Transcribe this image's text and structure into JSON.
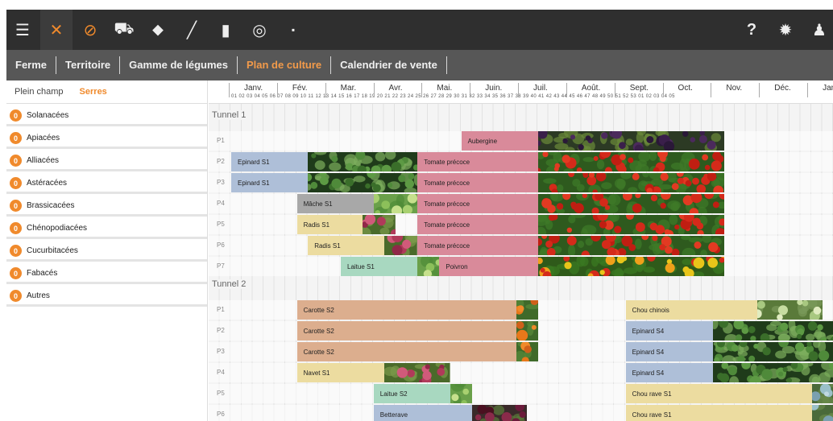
{
  "toolbar": {
    "items": [
      {
        "name": "menu-icon",
        "glyph": "☰"
      },
      {
        "name": "tools-icon",
        "glyph": "✕"
      },
      {
        "name": "compass-icon",
        "glyph": "⊘"
      },
      {
        "name": "tractor-icon",
        "glyph": "⛟"
      },
      {
        "name": "tag-icon",
        "glyph": "⬥"
      },
      {
        "name": "pen-icon",
        "glyph": "╱"
      },
      {
        "name": "bar-chart-icon",
        "glyph": "▮"
      },
      {
        "name": "gauge-icon",
        "glyph": "◎"
      },
      {
        "name": "flag-icon",
        "glyph": "▪"
      }
    ],
    "right": [
      {
        "name": "help-icon",
        "glyph": "?"
      },
      {
        "name": "settings-icon",
        "glyph": "✹"
      },
      {
        "name": "user-icon",
        "glyph": "♟"
      }
    ],
    "accent": "#f08a2c"
  },
  "subnav": {
    "tabs": [
      "Ferme",
      "Territoire",
      "Gamme de légumes",
      "Plan de culture",
      "Calendrier de vente"
    ],
    "active": "Plan de culture"
  },
  "sidebar": {
    "mode_open": "Plein champ",
    "mode_greenhouse": "Serres",
    "families": [
      {
        "count": "0",
        "name": "Solanacées"
      },
      {
        "count": "0",
        "name": "Apiacées"
      },
      {
        "count": "0",
        "name": "Alliacées"
      },
      {
        "count": "0",
        "name": "Astéracées"
      },
      {
        "count": "0",
        "name": "Brassicacées"
      },
      {
        "count": "0",
        "name": "Chénopodiacées"
      },
      {
        "count": "0",
        "name": "Cucurbitacées"
      },
      {
        "count": "0",
        "name": "Fabacés"
      },
      {
        "count": "0",
        "name": "Autres"
      }
    ]
  },
  "timeline": {
    "months": [
      "Janv.",
      "Fév.",
      "Mar.",
      "Avr.",
      "Mai.",
      "Juin.",
      "Juil.",
      "Août.",
      "Sept.",
      "Oct.",
      "Nov.",
      "Déc.",
      "Janv."
    ],
    "weeks": "01 02 03 04 05 06 07 08 09 10 11 12 13 14 15 16 17 18 19 20 21 22 23 24 25 26 27 28 29 30 31 32 33 34 35 36 37 38 39 40 41 42 43 44 45 46 47 48 49 50 51 52 53 01 02 03 04 05"
  },
  "tunnels": [
    {
      "name": "Tunnel 1",
      "rows": [
        {
          "label": "P1",
          "crops": [
            {
              "name": "Aubergine",
              "start": 22,
              "end": 29,
              "color": "#d98a9a",
              "photo": "aubergine",
              "pstart": 29,
              "pend": 46
            }
          ]
        },
        {
          "label": "P2",
          "crops": [
            {
              "name": "Epinard S1",
              "start": 1,
              "end": 8,
              "color": "#aebfd8",
              "photo": "spinach",
              "pstart": 8,
              "pend": 18
            },
            {
              "name": "Tomate précoce",
              "start": 18,
              "end": 29,
              "color": "#d98a9a",
              "photo": "tomato",
              "pstart": 29,
              "pend": 46
            }
          ]
        },
        {
          "label": "P3",
          "crops": [
            {
              "name": "Epinard S1",
              "start": 1,
              "end": 8,
              "color": "#aebfd8",
              "photo": "spinach",
              "pstart": 8,
              "pend": 18
            },
            {
              "name": "Tomate précoce",
              "start": 18,
              "end": 29,
              "color": "#d98a9a",
              "photo": "tomato",
              "pstart": 29,
              "pend": 46
            }
          ]
        },
        {
          "label": "P4",
          "crops": [
            {
              "name": "Mâche S1",
              "start": 7,
              "end": 14,
              "color": "#a8a8a8",
              "photo": "lettuce",
              "pstart": 14,
              "pend": 18
            },
            {
              "name": "Tomate précoce",
              "start": 18,
              "end": 29,
              "color": "#d98a9a",
              "photo": "tomato",
              "pstart": 29,
              "pend": 46
            }
          ]
        },
        {
          "label": "P5",
          "crops": [
            {
              "name": "Radis S1",
              "start": 7,
              "end": 13,
              "color": "#ecdca0",
              "photo": "radish",
              "pstart": 13,
              "pend": 16
            },
            {
              "name": "Tomate précoce",
              "start": 18,
              "end": 29,
              "color": "#d98a9a",
              "photo": "tomato",
              "pstart": 29,
              "pend": 46
            }
          ]
        },
        {
          "label": "P6",
          "crops": [
            {
              "name": "Radis S1",
              "start": 8,
              "end": 15,
              "color": "#ecdca0",
              "photo": "radish",
              "pstart": 15,
              "pend": 18
            },
            {
              "name": "Tomate précoce",
              "start": 18,
              "end": 29,
              "color": "#d98a9a",
              "photo": "tomato",
              "pstart": 29,
              "pend": 46
            }
          ]
        },
        {
          "label": "P7",
          "crops": [
            {
              "name": "Laitue S1",
              "start": 11,
              "end": 18,
              "color": "#a8d8c0",
              "photo": "lettuce",
              "pstart": 18,
              "pend": 20
            },
            {
              "name": "Poivron",
              "start": 20,
              "end": 29,
              "color": "#d98a9a",
              "photo": "pepper",
              "pstart": 29,
              "pend": 46
            }
          ]
        }
      ]
    },
    {
      "name": "Tunnel 2",
      "rows": [
        {
          "label": "P1",
          "crops": [
            {
              "name": "Carotte S2",
              "start": 7,
              "end": 27,
              "color": "#dcae8e",
              "photo": "carrot",
              "pstart": 27,
              "pend": 29
            },
            {
              "name": "Chou chinois",
              "start": 37,
              "end": 49,
              "color": "#ecdca0",
              "photo": "cabbage",
              "pstart": 49,
              "pend": 55
            }
          ]
        },
        {
          "label": "P2",
          "crops": [
            {
              "name": "Carotte S2",
              "start": 7,
              "end": 27,
              "color": "#dcae8e",
              "photo": "carrot",
              "pstart": 27,
              "pend": 29
            },
            {
              "name": "Epinard S4",
              "start": 37,
              "end": 45,
              "color": "#aebfd8",
              "photo": "spinach",
              "pstart": 45,
              "pend": 58
            }
          ]
        },
        {
          "label": "P3",
          "crops": [
            {
              "name": "Carotte S2",
              "start": 7,
              "end": 27,
              "color": "#dcae8e",
              "photo": "carrot",
              "pstart": 27,
              "pend": 29
            },
            {
              "name": "Epinard S4",
              "start": 37,
              "end": 45,
              "color": "#aebfd8",
              "photo": "spinach",
              "pstart": 45,
              "pend": 58
            }
          ]
        },
        {
          "label": "P4",
          "crops": [
            {
              "name": "Navet S1",
              "start": 7,
              "end": 15,
              "color": "#ecdca0",
              "photo": "radish",
              "pstart": 15,
              "pend": 21
            },
            {
              "name": "Epinard S4",
              "start": 37,
              "end": 45,
              "color": "#aebfd8",
              "photo": "spinach",
              "pstart": 45,
              "pend": 58
            }
          ]
        },
        {
          "label": "P5",
          "crops": [
            {
              "name": "Laitue S2",
              "start": 14,
              "end": 21,
              "color": "#a8d8c0",
              "photo": "lettuce",
              "pstart": 21,
              "pend": 23
            },
            {
              "name": "Chou rave S1",
              "start": 37,
              "end": 54,
              "color": "#ecdca0",
              "photo": "kohlrabi",
              "pstart": 54,
              "pend": 58
            }
          ]
        },
        {
          "label": "P6",
          "crops": [
            {
              "name": "Betterave",
              "start": 14,
              "end": 23,
              "color": "#aebfd8",
              "photo": "beet",
              "pstart": 23,
              "pend": 28
            },
            {
              "name": "Chou rave S1",
              "start": 37,
              "end": 54,
              "color": "#ecdca0",
              "photo": "kohlrabi",
              "pstart": 54,
              "pend": 58
            }
          ]
        }
      ]
    }
  ]
}
